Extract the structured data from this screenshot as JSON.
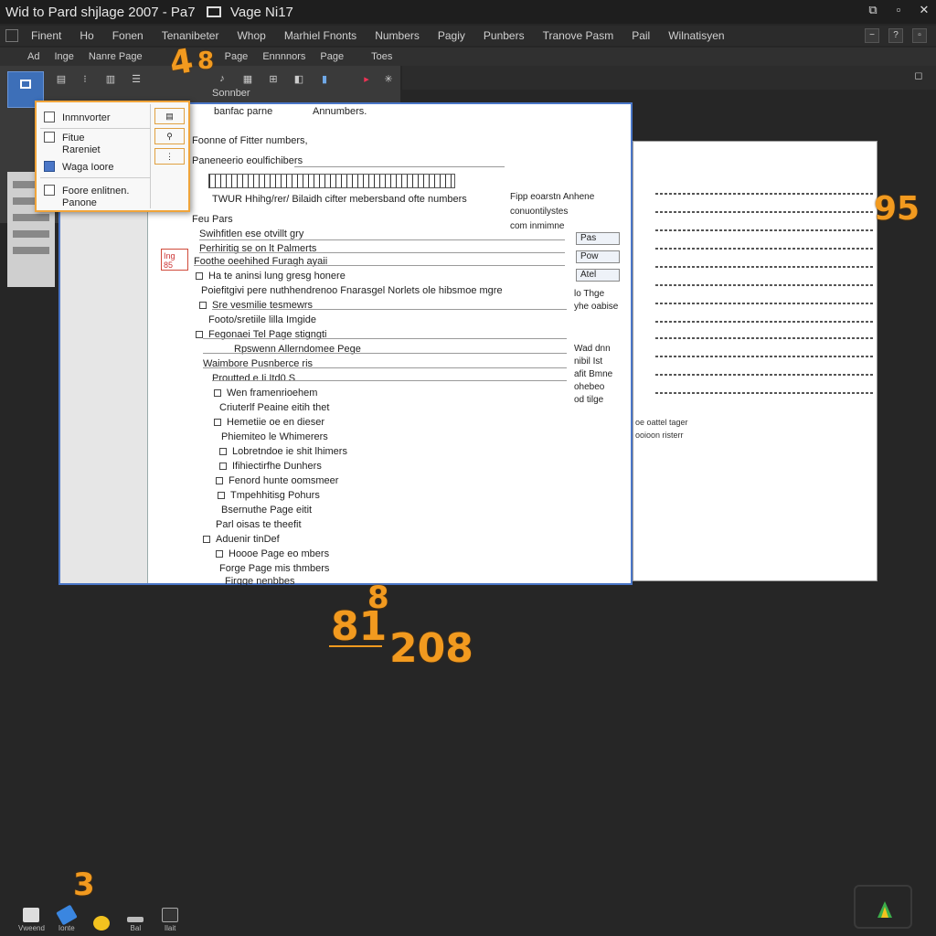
{
  "window": {
    "title": "Wid to Pard shjlage 2007 - Pa7",
    "title_suffix": "Vage Ni17"
  },
  "menubar": [
    "Finent",
    "Ho",
    "Fonen",
    "Tenanibeter",
    "Whop",
    "Marhiel Fnonts",
    "Numbers",
    "Pagiy",
    "Punbers",
    "Tranove Pasm",
    "Pail",
    "Wilnatisyen"
  ],
  "tabs": [
    "Ad",
    "Inge",
    "Nanre Page",
    "Page",
    "Ennnnors",
    "Page",
    "Toes"
  ],
  "ribbon": {
    "labels": [
      "Sonnber",
      "banfac parne",
      "Annumbers."
    ]
  },
  "dropdown": {
    "items": [
      {
        "label": "Inmnvorter"
      },
      {
        "label": "Fitue"
      },
      {
        "label": "Rareniet"
      },
      {
        "label": "Waga Ioore"
      },
      {
        "label": "Foore enlitnen."
      },
      {
        "label": "Panone"
      }
    ]
  },
  "document": {
    "lines": [
      "Foonne of Fitter numbers,",
      "Paneneerio eoulfichibers",
      "TWUR Hhihg/rer/ Bilaidh cifter mebersband ofte numbers",
      "Feu Pars",
      "Swihfitlen ese otvillt gry",
      "Perhiritig se on lt Palmerts",
      "Foothe oeehihed Furagh ayaii",
      "Ha te aninsi lung gresg honere",
      "Poiefitgivi pere nuthhendrenoo Fnarasgel Norlets ole hibsmoe mgre",
      "Sre vesmilie tesmewrs",
      "Footo/sretiile lilla Imgide",
      "Fegonaei Tel Page stigngti",
      "Rpswenn Allerndomee Pege",
      "Waimbore Pusnberce ris",
      "Proutted e Ii Itd0 S",
      "Wen framenrioehem",
      "Criuterlf Peaine eitih thet",
      "Hemetiie oe en dieser",
      "Phiemiteo le Whimerers",
      "Lobretndoe ie shit lhimers",
      "Ifihiectirfhe Dunhers",
      "Fenord hunte oomsmeer",
      "Tmpehhitisg Pohurs",
      "Bsernuthe Page eitit",
      "Parl oisas te theefit",
      "Aduenir tinDef",
      "Hoooe Page eo mbers",
      "Forge Page mis thmbers",
      "Firgge nenbbes"
    ],
    "side_notes": [
      "Fipp eoarstn Anhene",
      "conuontilystes",
      "com inmimne"
    ],
    "side_boxes": [
      "Pas",
      "Pow",
      "Atel"
    ],
    "side_small": [
      "lo Thge",
      "yhe oabise",
      "Wad dnn",
      "nibil Ist",
      "afit Bmne",
      "ohebeo",
      "od tilge"
    ],
    "red_box": "Ing 85"
  },
  "page2": {
    "text": [
      "oe oattel tager",
      "ooioon risterr"
    ]
  },
  "callouts": {
    "top": "4",
    "top2": "8",
    "right": "95",
    "center_a": "8",
    "center_b": "81",
    "center_c": "208",
    "bottom": "3"
  },
  "taskbar": {
    "items": [
      "Vweend",
      "Ionte",
      "",
      "Bal",
      "Ilait"
    ]
  },
  "colors": {
    "accent": "#f29a1f",
    "ribbon_active": "#3d6fb8",
    "background": "#262626"
  }
}
